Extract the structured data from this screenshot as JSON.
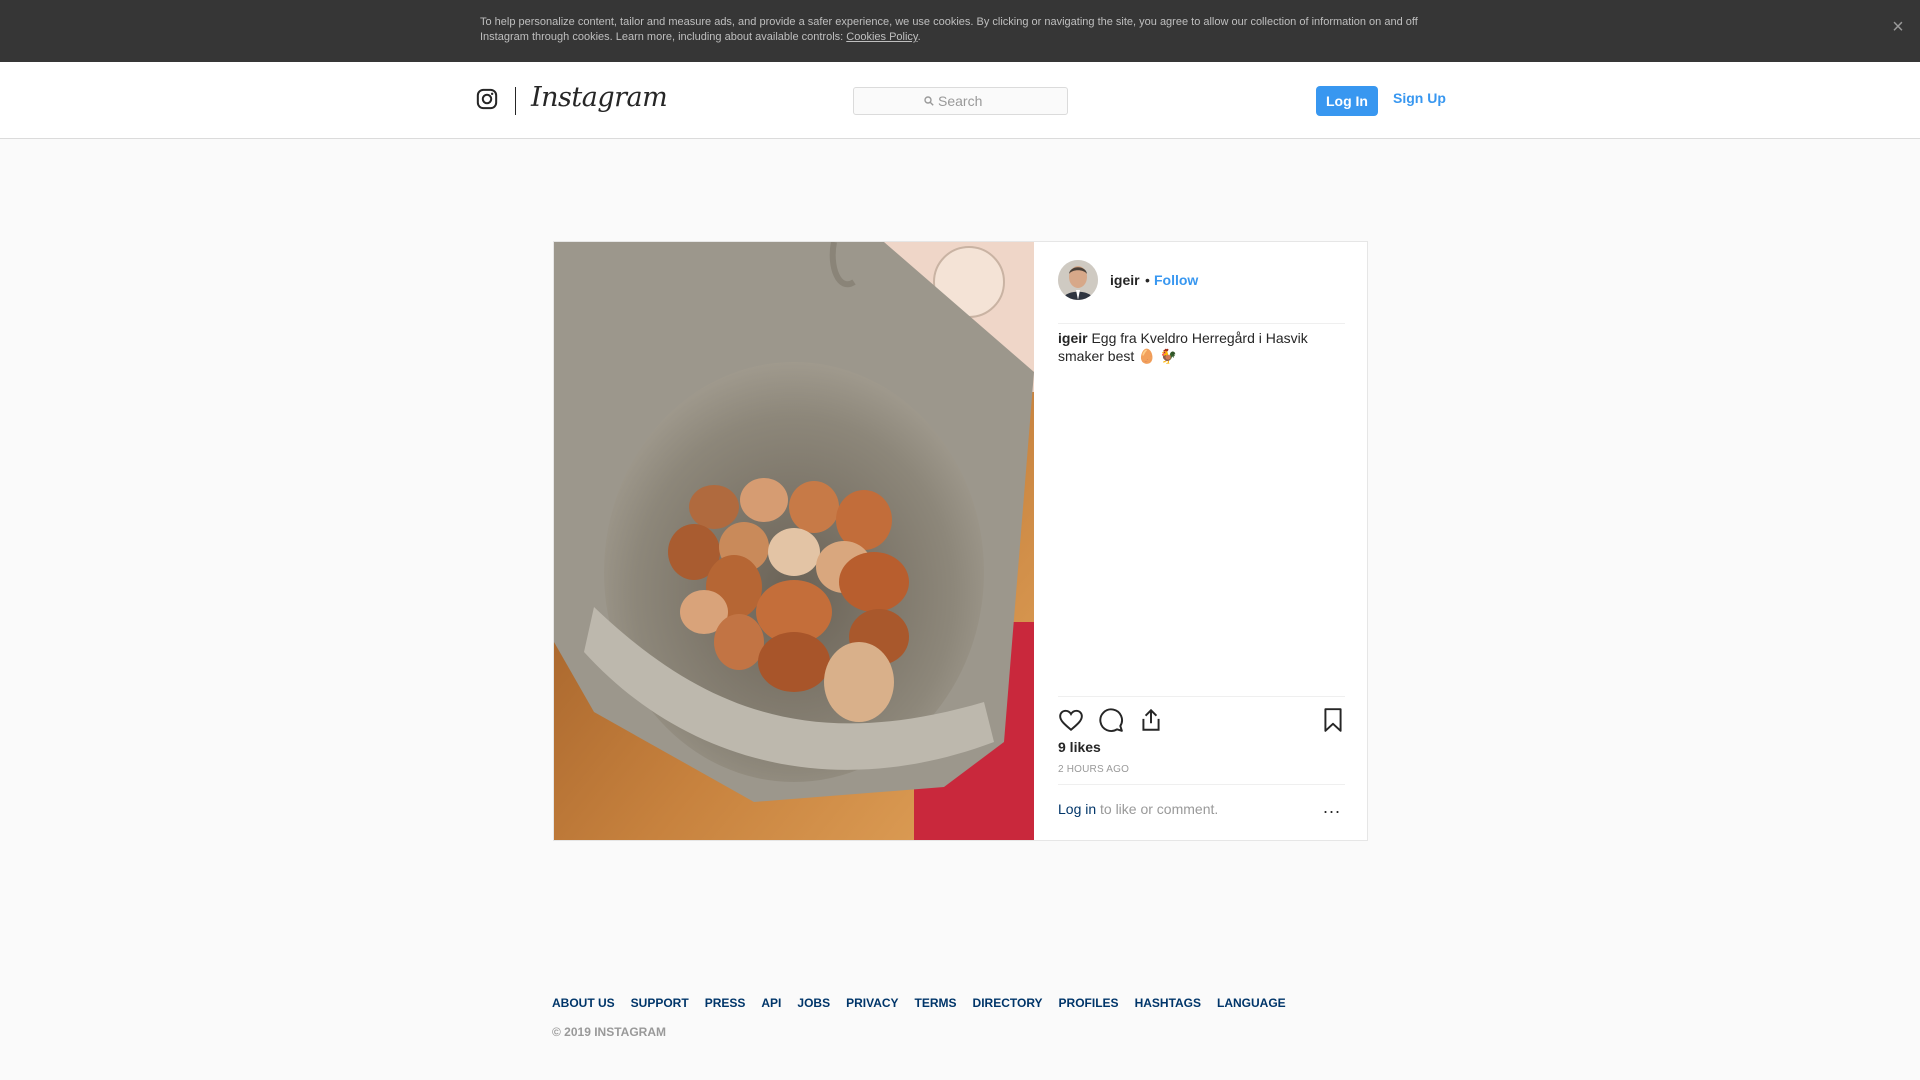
{
  "cookie_banner": {
    "text": "To help personalize content, tailor and measure ads, and provide a safer experience, we use cookies. By clicking or navigating the site, you agree to allow our collection of information on and off Instagram through cookies. Learn more, including about available controls: ",
    "link": "Cookies Policy",
    "close": "×"
  },
  "header": {
    "brand": "Instagram",
    "search_placeholder": "Search",
    "login": "Log In",
    "signup": "Sign Up"
  },
  "post": {
    "author": "igeir",
    "separator": "•",
    "follow": "Follow",
    "caption_author": "igeir",
    "caption_text": "Egg fra Kveldro Herregård i Hasvik smaker best 🥚 🐓",
    "likes": "9 likes",
    "time": "2 HOURS AGO",
    "login_link": "Log in",
    "comment_prompt": "to like or comment.",
    "more": "..."
  },
  "footer": {
    "links": [
      "ABOUT US",
      "SUPPORT",
      "PRESS",
      "API",
      "JOBS",
      "PRIVACY",
      "TERMS",
      "DIRECTORY",
      "PROFILES",
      "HASHTAGS",
      "LANGUAGE"
    ],
    "copyright": "© 2019 INSTAGRAM"
  },
  "colors": {
    "accent": "#3897f0",
    "link_dark": "#003569",
    "banner_bg": "#363636"
  }
}
